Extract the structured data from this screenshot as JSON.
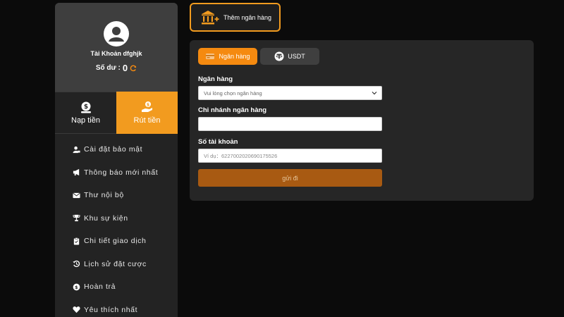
{
  "profile": {
    "account_name": "Tài Khoản dfghjk",
    "balance_label": "Số dư :",
    "balance_value": "0"
  },
  "actions": {
    "deposit_label": "Nạp tiền",
    "withdraw_label": "Rút tiền"
  },
  "menu": [
    {
      "label": "Cài đặt bảo mật",
      "icon": "user-lock-icon"
    },
    {
      "label": "Thông báo mới nhất",
      "icon": "megaphone-icon"
    },
    {
      "label": "Thư nội bộ",
      "icon": "envelope-icon"
    },
    {
      "label": "Khu sự kiện",
      "icon": "trophy-icon"
    },
    {
      "label": "Chi tiết giao dịch",
      "icon": "clipboard-icon"
    },
    {
      "label": "Lịch sử đặt cược",
      "icon": "history-icon"
    },
    {
      "label": "Hoàn trả",
      "icon": "coin-icon"
    },
    {
      "label": "Yêu thích nhất",
      "icon": "heart-icon"
    }
  ],
  "add_bank": {
    "label": "Thêm ngân hàng"
  },
  "tabs": {
    "bank": "Ngân hàng",
    "usdt": "USDT"
  },
  "form": {
    "bank_label": "Ngân hàng",
    "bank_select_value": "Vui lòng chọn ngân hàng",
    "branch_label": "Chi nhánh ngân hàng",
    "branch_value": "",
    "account_label": "Số tài khoản",
    "account_placeholder": "Ví dụ：6227002020690175526",
    "submit_label": "gửi đi"
  },
  "colors": {
    "accent": "#f29b1f",
    "tab_active": "#f58a10",
    "submit_bg": "#a85a12",
    "panel_bg": "#262626",
    "sidebar_bg": "#232323"
  }
}
